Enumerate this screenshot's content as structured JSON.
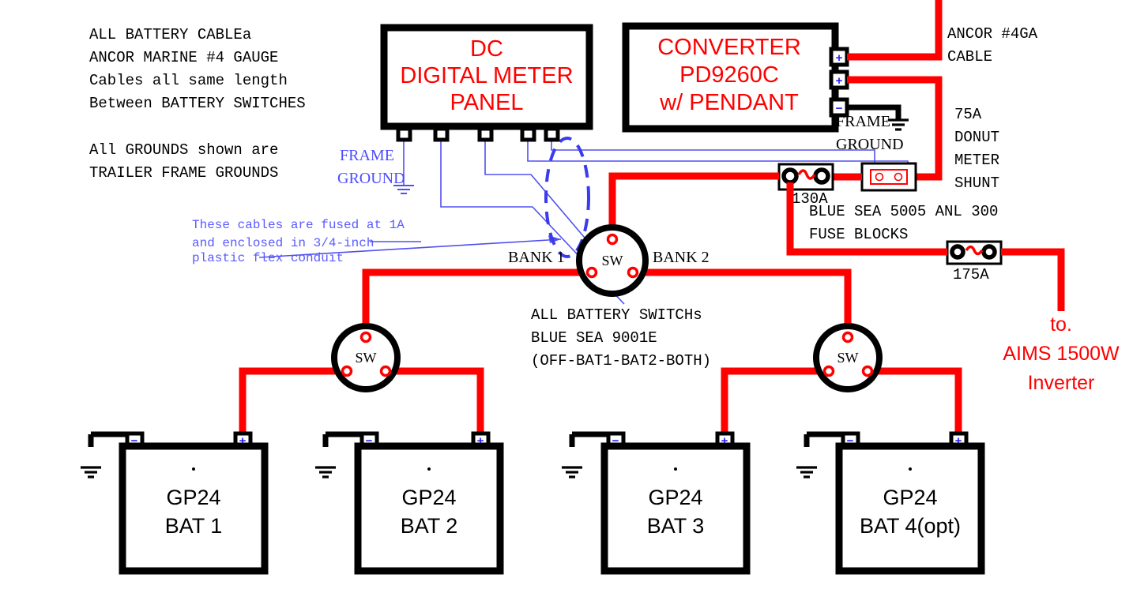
{
  "notes": {
    "cable_note": [
      "ALL BATTERY CABLEa",
      "ANCOR MARINE #4 GAUGE",
      "Cables all same length",
      "Between BATTERY SWITCHES"
    ],
    "ground_note": [
      "All GROUNDS shown are",
      "TRAILER FRAME GROUNDS"
    ],
    "fuse_note": [
      "These cables are fused at 1A",
      "and enclosed in 3/4-inch",
      "plastic flex conduit"
    ],
    "switch_note": [
      "ALL BATTERY SWITCHs",
      "BLUE SEA 9001E",
      "(OFF-BAT1-BAT2-BOTH)"
    ],
    "fuse_block_note": [
      "BLUE SEA 5005 ANL 300",
      "FUSE BLOCKS"
    ],
    "ancor_cable": [
      "ANCOR #4GA",
      "CABLE"
    ],
    "shunt_note": [
      "75A",
      "DONUT",
      "METER",
      "SHUNT"
    ]
  },
  "panels": {
    "meter_panel": {
      "lines": [
        "DC",
        "DIGITAL METER",
        "PANEL"
      ],
      "terminal_count": 5
    },
    "converter": {
      "lines": [
        "CONVERTER",
        "PD9260C",
        "w/ PENDANT"
      ],
      "terminals": [
        "+",
        "+",
        "−"
      ],
      "ground_label": [
        "FRAME",
        "GROUND"
      ]
    }
  },
  "labels": {
    "frame_ground": [
      "FRAME",
      "GROUND"
    ],
    "bank_1": "BANK 1",
    "bank_2": "BANK 2",
    "switch_text": "SW",
    "inverter": [
      "to.",
      "AIMS 1500W",
      "Inverter"
    ]
  },
  "fuses": [
    {
      "name": "fuse-130a",
      "amp": "130A"
    },
    {
      "name": "fuse-175a",
      "amp": "175A"
    }
  ],
  "batteries": [
    {
      "id": "bat1",
      "model": "GP24",
      "name": "BAT 1",
      "neg": "−",
      "pos": "+"
    },
    {
      "id": "bat2",
      "model": "GP24",
      "name": "BAT 2",
      "neg": "−",
      "pos": "+"
    },
    {
      "id": "bat3",
      "model": "GP24",
      "name": "BAT 3",
      "neg": "−",
      "pos": "+"
    },
    {
      "id": "bat4",
      "model": "GP24",
      "name": "BAT 4(opt)",
      "neg": "−",
      "pos": "+"
    }
  ],
  "switches": [
    {
      "id": "sw-bank-main",
      "label": "SW"
    },
    {
      "id": "sw-bank-1",
      "label": "SW"
    },
    {
      "id": "sw-bank-2",
      "label": "SW"
    }
  ],
  "colors": {
    "positive_wire": "#ff0000",
    "ground_wire": "#000000",
    "signal_wire": "#5050f0",
    "heading": "#ff0000",
    "annotation": "#5a5aff"
  }
}
